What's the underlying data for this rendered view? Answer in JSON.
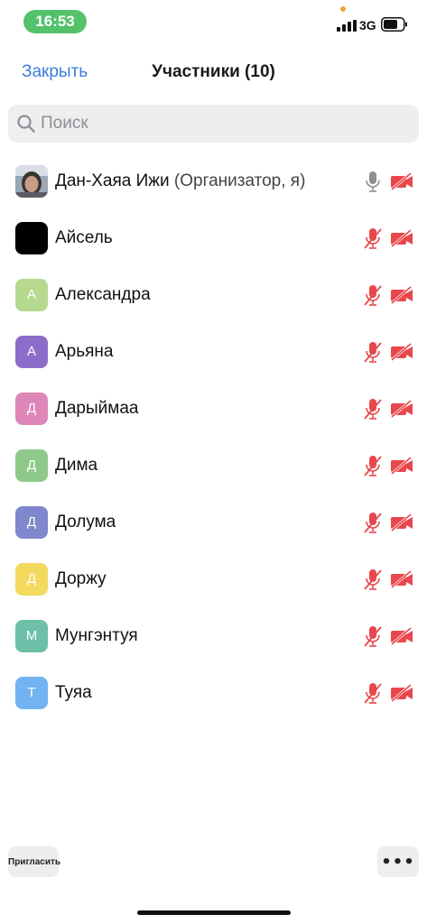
{
  "status_bar": {
    "time": "16:53",
    "network": "3G"
  },
  "header": {
    "close_label": "Закрыть",
    "title": "Участники (10)"
  },
  "search": {
    "placeholder": "Поиск",
    "value": ""
  },
  "participants": [
    {
      "name": "Дан-Хаяа Ижи",
      "role": "(Организатор, я)",
      "initial": "",
      "avatar_color": "#7d8aa0",
      "photo": true,
      "mic_muted": false,
      "video_off": true
    },
    {
      "name": "Айсель",
      "role": "",
      "initial": "",
      "avatar_color": "#000000",
      "photo": false,
      "mic_muted": true,
      "video_off": true
    },
    {
      "name": "Александра",
      "role": "",
      "initial": "А",
      "avatar_color": "#b4d98f",
      "photo": false,
      "mic_muted": true,
      "video_off": true
    },
    {
      "name": "Арьяна",
      "role": "",
      "initial": "А",
      "avatar_color": "#8e6cc9",
      "photo": false,
      "mic_muted": true,
      "video_off": true
    },
    {
      "name": "Дарыймаа",
      "role": "",
      "initial": "Д",
      "avatar_color": "#df86b8",
      "photo": false,
      "mic_muted": true,
      "video_off": true
    },
    {
      "name": "Дима",
      "role": "",
      "initial": "Д",
      "avatar_color": "#8fc98a",
      "photo": false,
      "mic_muted": true,
      "video_off": true
    },
    {
      "name": "Долума",
      "role": "",
      "initial": "Д",
      "avatar_color": "#7f88cc",
      "photo": false,
      "mic_muted": true,
      "video_off": true
    },
    {
      "name": "Доржу",
      "role": "",
      "initial": "Д",
      "avatar_color": "#f3d95e",
      "photo": false,
      "mic_muted": true,
      "video_off": true
    },
    {
      "name": "Мунгэнтуя",
      "role": "",
      "initial": "М",
      "avatar_color": "#6dbfa8",
      "photo": false,
      "mic_muted": true,
      "video_off": true
    },
    {
      "name": "Туяа",
      "role": "",
      "initial": "Т",
      "avatar_color": "#72b3f2",
      "photo": false,
      "mic_muted": true,
      "video_off": true
    }
  ],
  "footer": {
    "invite_label": "Пригласить",
    "more_label": "•••"
  },
  "colors": {
    "accent": "#3a7de0",
    "muted_red": "#e8474c",
    "mic_gray": "#8e8e93",
    "status_green": "#54c16b"
  },
  "icons": {
    "search": "search-icon",
    "mic": "microphone-icon",
    "mic_muted": "microphone-muted-icon",
    "video_off": "video-off-icon"
  }
}
